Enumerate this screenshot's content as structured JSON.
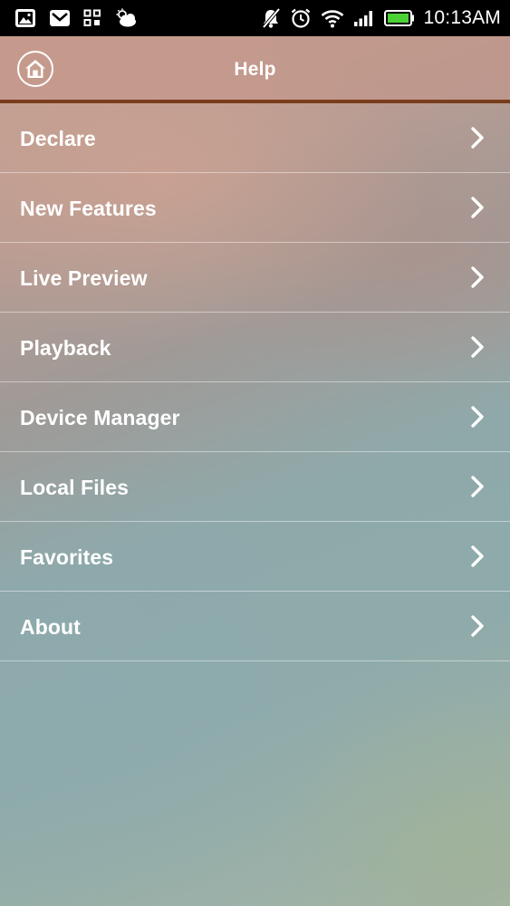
{
  "status_bar": {
    "time": "10:13AM",
    "left_icons": [
      "image-icon",
      "mail-icon",
      "grid-apps-icon",
      "weather-cloud-icon"
    ],
    "right_icons": [
      "muted-bell-icon",
      "alarm-icon",
      "wifi-icon",
      "signal-icon",
      "battery-icon"
    ]
  },
  "header": {
    "title": "Help",
    "home_icon": "home-icon"
  },
  "menu": {
    "items": [
      {
        "label": "Declare"
      },
      {
        "label": "New Features"
      },
      {
        "label": "Live Preview"
      },
      {
        "label": "Playback"
      },
      {
        "label": "Device Manager"
      },
      {
        "label": "Local Files"
      },
      {
        "label": "Favorites"
      },
      {
        "label": "About"
      }
    ],
    "chevron_icon": "chevron-right-icon"
  },
  "colors": {
    "header_accent_line": "#7a3d1c",
    "status_bar_bg": "#000000",
    "text": "#ffffff",
    "battery_fill": "#4cd137"
  }
}
